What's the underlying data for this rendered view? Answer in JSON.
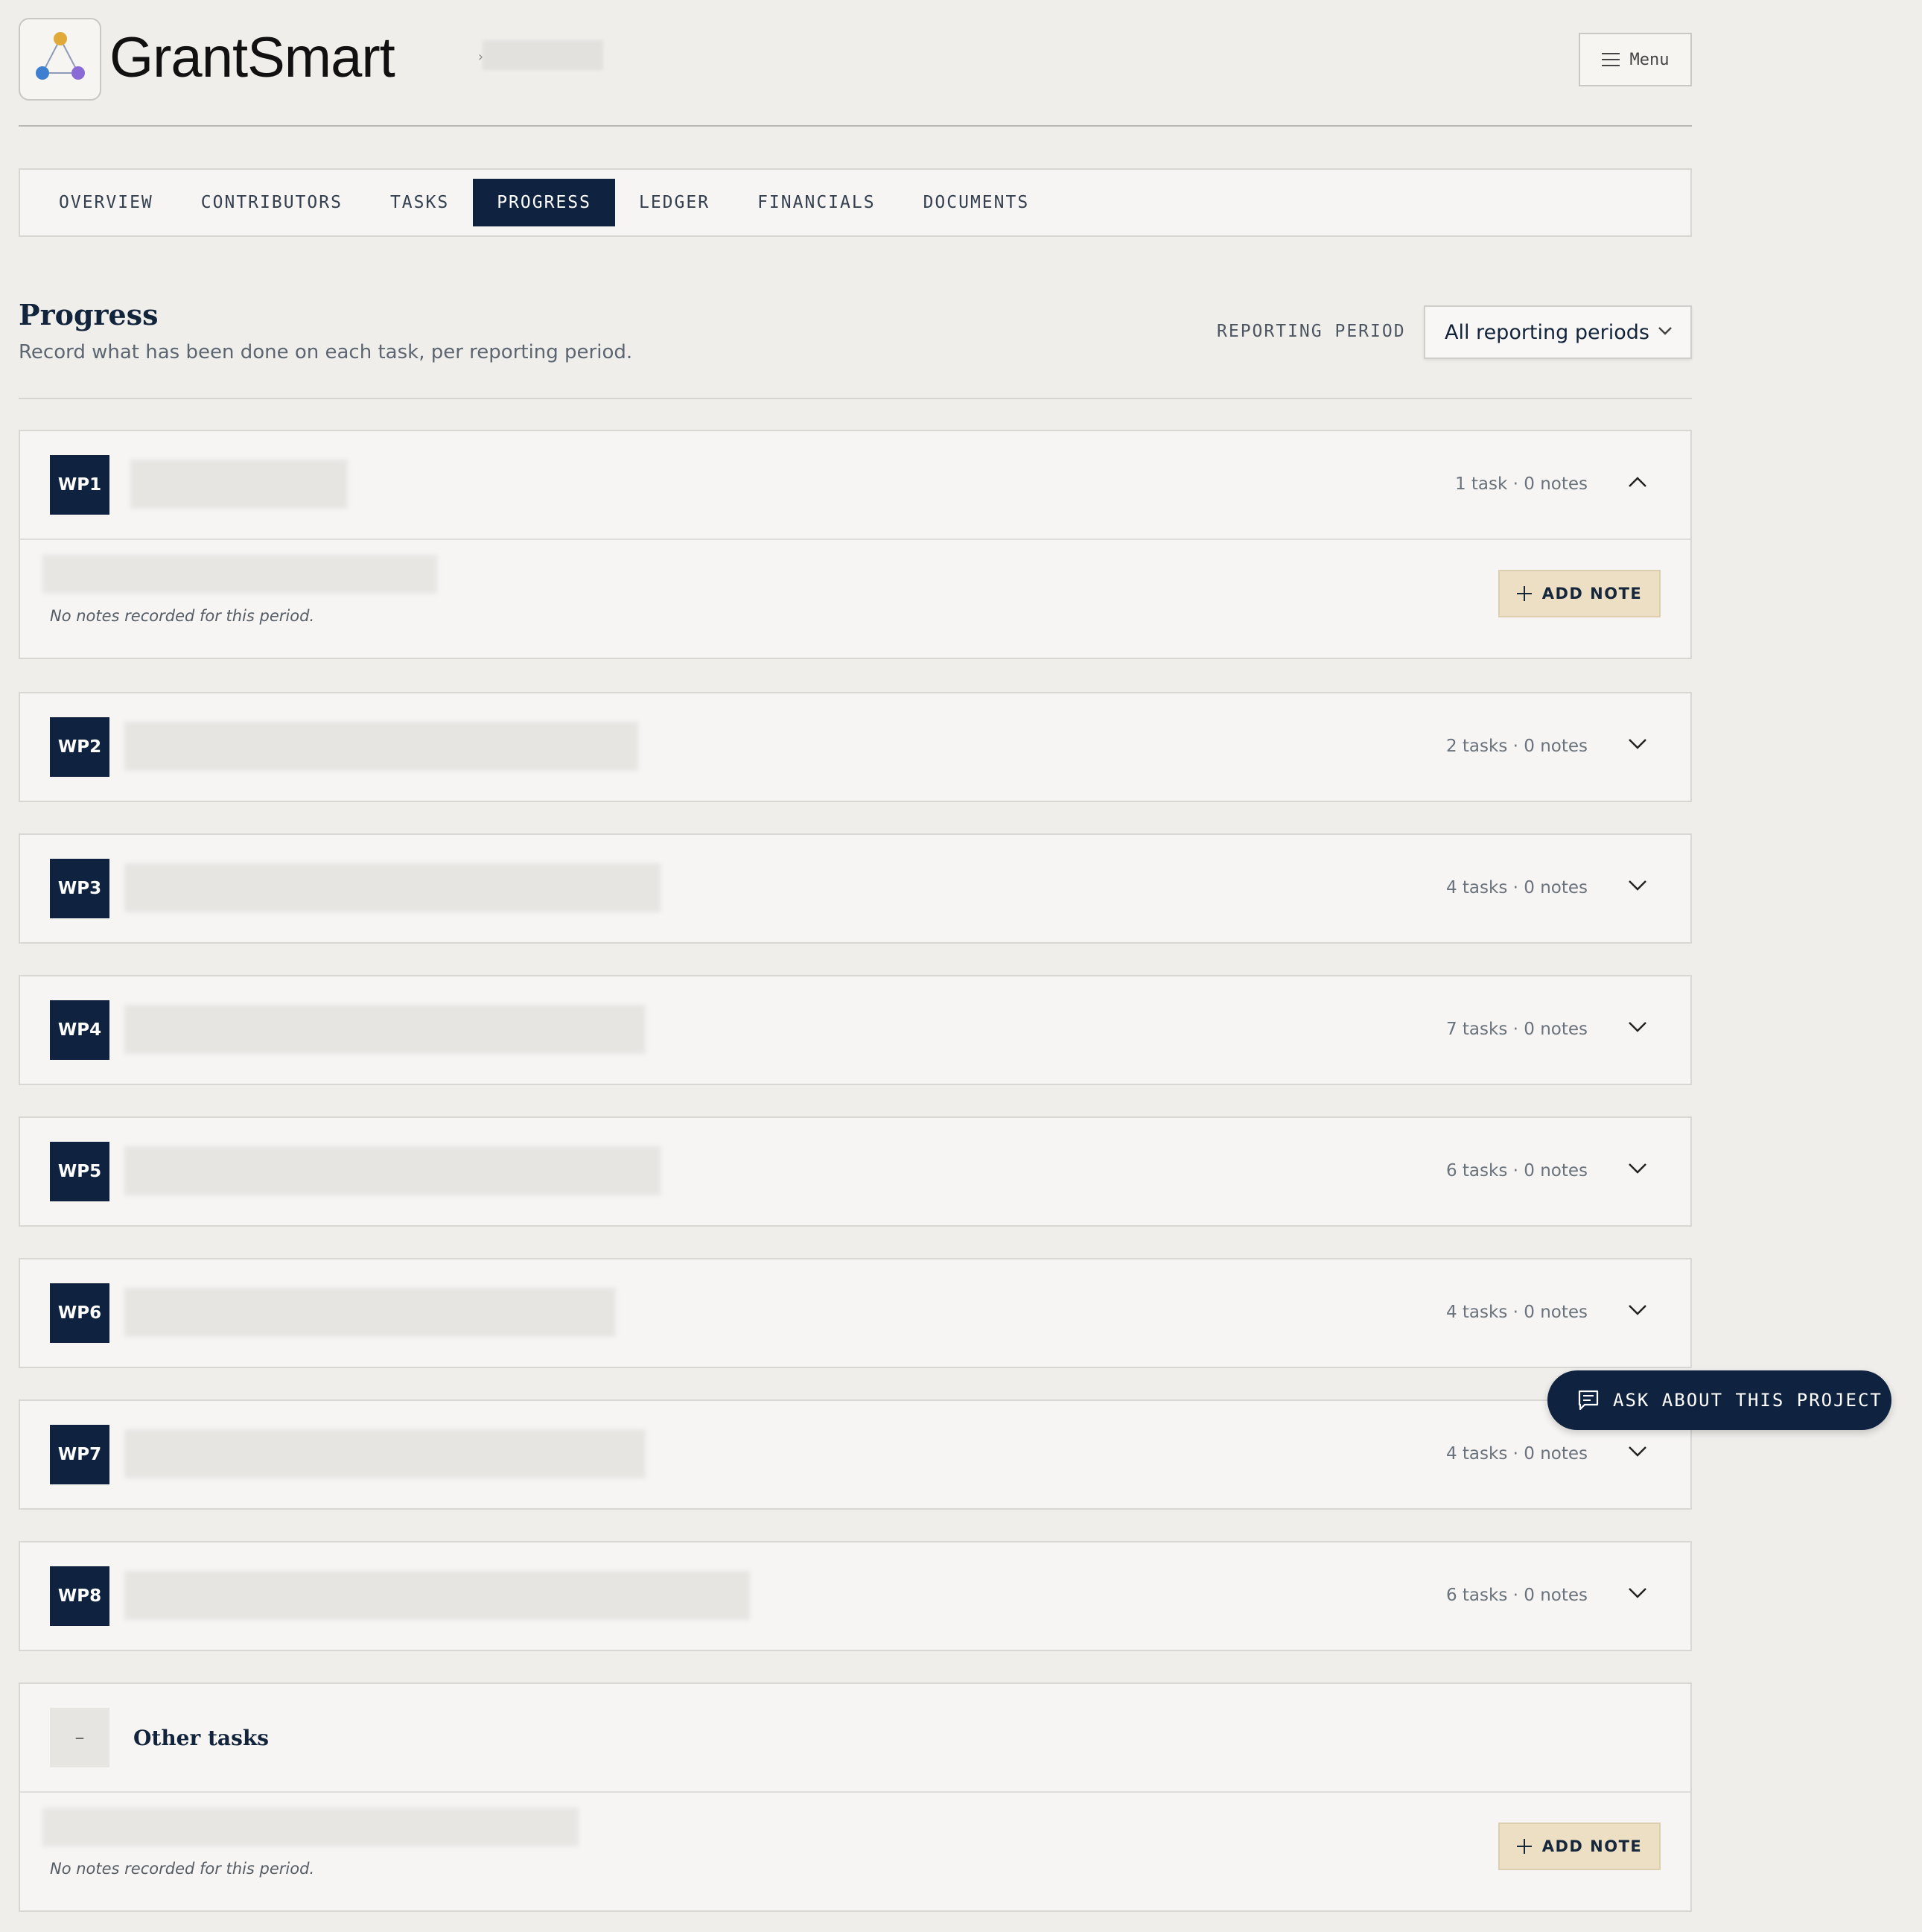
{
  "app": {
    "name": "GrantSmart",
    "breadcrumb_sep": "›"
  },
  "header": {
    "menu_label": "Menu"
  },
  "tabs": [
    {
      "label": "OVERVIEW"
    },
    {
      "label": "CONTRIBUTORS"
    },
    {
      "label": "TASKS"
    },
    {
      "label": "PROGRESS",
      "active": true
    },
    {
      "label": "LEDGER"
    },
    {
      "label": "FINANCIALS"
    },
    {
      "label": "DOCUMENTS"
    }
  ],
  "section": {
    "title": "Progress",
    "subtitle": "Record what has been done on each task, per reporting period.",
    "period_label": "REPORTING PERIOD",
    "period_value": "All reporting periods"
  },
  "work_packages": [
    {
      "code": "WP1",
      "meta": "1 task · 0 notes",
      "expanded": true
    },
    {
      "code": "WP2",
      "meta": "2 tasks · 0 notes",
      "expanded": false
    },
    {
      "code": "WP3",
      "meta": "4 tasks · 0 notes",
      "expanded": false
    },
    {
      "code": "WP4",
      "meta": "7 tasks · 0 notes",
      "expanded": false
    },
    {
      "code": "WP5",
      "meta": "6 tasks · 0 notes",
      "expanded": false
    },
    {
      "code": "WP6",
      "meta": "4 tasks · 0 notes",
      "expanded": false
    },
    {
      "code": "WP7",
      "meta": "4 tasks · 0 notes",
      "expanded": false
    },
    {
      "code": "WP8",
      "meta": "6 tasks · 0 notes",
      "expanded": false
    }
  ],
  "wp1_body": {
    "empty_text": "No notes recorded for this period.",
    "add_label": "ADD NOTE"
  },
  "other": {
    "badge": "–",
    "title": "Other tasks",
    "empty_text": "No notes recorded for this period.",
    "add_label": "ADD NOTE"
  },
  "ask_button": {
    "label": "ASK ABOUT THIS PROJECT"
  },
  "colors": {
    "navy": "#0f2340",
    "add_note_bg": "#ecdfc3",
    "page_bg": "#efeeeb"
  }
}
